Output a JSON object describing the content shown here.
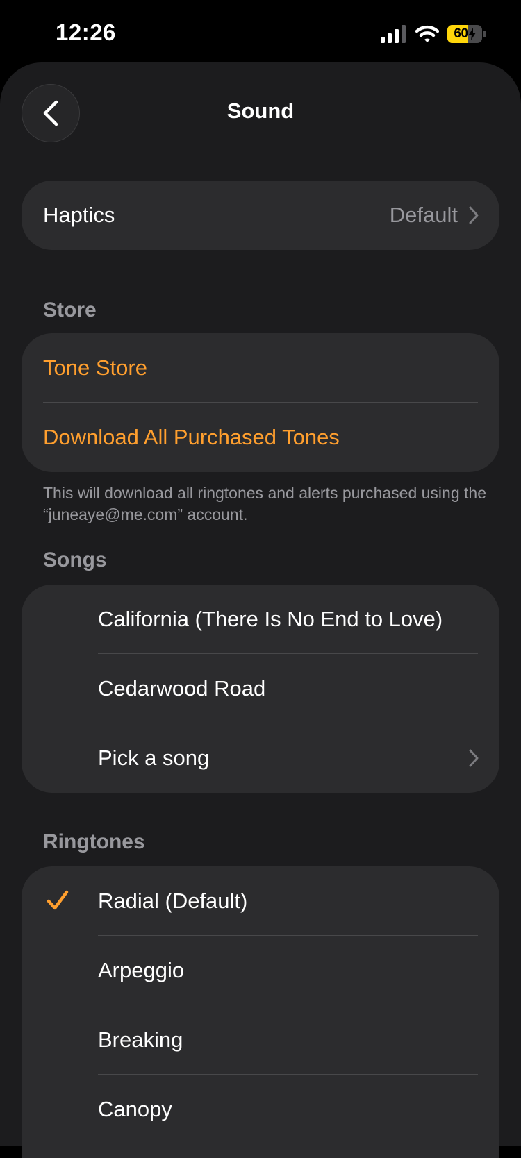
{
  "status": {
    "time": "12:26",
    "battery": "60",
    "battery_fill": 0.6
  },
  "nav": {
    "title": "Sound"
  },
  "haptics": {
    "label": "Haptics",
    "value": "Default"
  },
  "store": {
    "header": "Store",
    "items": [
      {
        "label": "Tone Store"
      },
      {
        "label": "Download All Purchased Tones"
      }
    ],
    "footnote": "This will download all ringtones and alerts purchased using the “juneaye@me.com” account."
  },
  "songs": {
    "header": "Songs",
    "items": [
      {
        "label": "California (There Is No End to Love)"
      },
      {
        "label": "Cedarwood Road"
      },
      {
        "label": "Pick a song"
      }
    ]
  },
  "ringtones": {
    "header": "Ringtones",
    "selected": "Radial (Default)",
    "items": [
      {
        "label": "Radial (Default)"
      },
      {
        "label": "Arpeggio"
      },
      {
        "label": "Breaking"
      },
      {
        "label": "Canopy"
      }
    ]
  },
  "colors": {
    "accent": "#ff9f2e",
    "background": "#1c1c1e",
    "cell": "#2c2c2e",
    "secondary": "#98989d"
  }
}
